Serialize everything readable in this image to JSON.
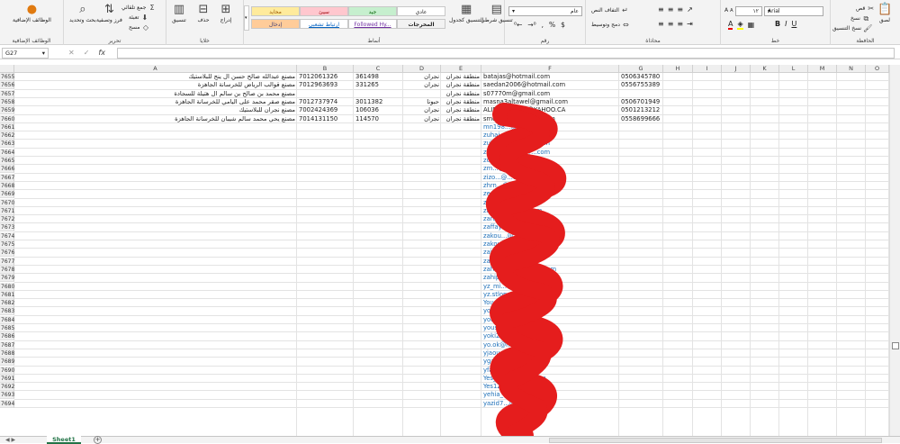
{
  "ribbon": {
    "clipboard": {
      "paste": "لصق",
      "cut": "قص",
      "copy": "نسخ",
      "format_painter": "نسخ التنسيق",
      "label": "الحافظة"
    },
    "font": {
      "name": "Arial",
      "size": "١٢",
      "label": "خط"
    },
    "alignment": {
      "wrap": "التفاف النص",
      "merge": "دمج وتوسيط",
      "label": "محاذاة"
    },
    "number": {
      "format": "عام",
      "label": "رقم"
    },
    "styles": {
      "conditional": "تنسيق شرطي",
      "as_table": "التنسيق كجدول",
      "cells": [
        "عادي",
        "جيد",
        "سيئ",
        "محايد",
        "المخرجات",
        "Followed Hy...",
        "ارتباط تشعبي",
        "إدخال"
      ],
      "label": "أنماط"
    },
    "cells": {
      "insert": "إدراج",
      "delete": "حذف",
      "format": "تنسيق",
      "label": "خلايا"
    },
    "editing": {
      "autosum": "جمع تلقائي",
      "fill": "تعبئة",
      "clear": "مسح",
      "sort": "فرز وتصفية",
      "find": "بحث وتحديد",
      "label": "تحرير"
    },
    "addins": {
      "button": "الوظائف الإضافية",
      "label": "الوظائف الإضافية"
    }
  },
  "formula_bar": {
    "name_box": "G27",
    "fx": "fx",
    "value": ""
  },
  "columns": [
    "A",
    "B",
    "C",
    "D",
    "E",
    "F",
    "G",
    "H",
    "I",
    "J",
    "K",
    "L",
    "M",
    "N",
    "O"
  ],
  "rows": [
    {
      "n": "7655",
      "a": "مصنع عبدالله صالح حسن ال ينج للبلاستيك",
      "b": "7012061326",
      "c": "361498",
      "d": "نجران",
      "e": "منطقة نجران",
      "f": "batajas@hotmail.com",
      "g": "0506345780"
    },
    {
      "n": "7656",
      "a": "مصنع قوالب الرياض للخرسانة الجاهزة",
      "b": "7012963693",
      "c": "331265",
      "d": "نجران",
      "e": "منطقة نجران",
      "f": "saedan2006@hotmail.com",
      "g": "0556755389"
    },
    {
      "n": "7657",
      "a": "مصنع محمد بن صالح بن سالم ال هتيلة للسجادة",
      "b": "",
      "c": "",
      "d": "",
      "e": "منطقة نجران",
      "f": "s07770m@gmail.com",
      "g": ""
    },
    {
      "n": "7658",
      "a": "مصنع صقر محمد على اليامي للخرسانة الجاهزة",
      "b": "7012737974",
      "c": "3011382",
      "d": "حبونا",
      "e": "منطقة نجران",
      "f": "masna3altawel@gmail.com",
      "g": "0506701949"
    },
    {
      "n": "7659",
      "a": "مصنع نجران للبلاستيك",
      "b": "7002424369",
      "c": "106036",
      "d": "نجران",
      "e": "منطقة نجران",
      "f": "ALIBALHARITH@YAHOO.CA",
      "g": "0501213212"
    },
    {
      "n": "7660",
      "a": "مصنع يحي محمد سالم شيبان للخرسانة الجاهزة",
      "b": "7014131150",
      "c": "114570",
      "d": "نجران",
      "e": "منطقة نجران",
      "f": "smo_666@hotmail.com",
      "g": "0558699666"
    },
    {
      "n": "7661",
      "f": "mn198...@..."
    },
    {
      "n": "7662",
      "f": "zuhai...@..."
    },
    {
      "n": "7663",
      "f": "zuhair.ghan...@...com"
    },
    {
      "n": "7664",
      "f": "zuhairalgha...@...com"
    },
    {
      "n": "7665",
      "f": "zoy...@...com"
    },
    {
      "n": "7666",
      "f": "zm...@...com"
    },
    {
      "n": "7667",
      "f": "zizo...@...com"
    },
    {
      "n": "7668",
      "f": "zhrn...@..."
    },
    {
      "n": "7669",
      "f": "zeeefes...@...om"
    },
    {
      "n": "7670",
      "f": "zayed...@...m.sa"
    },
    {
      "n": "7671",
      "f": "zanayem...@...com"
    },
    {
      "n": "7672",
      "f": "zaree_n...@...m"
    },
    {
      "n": "7673",
      "f": "zaffay...@..."
    },
    {
      "n": "7674",
      "f": "zakou...@...sa"
    },
    {
      "n": "7675",
      "f": "zakou...@...oader.org"
    },
    {
      "n": "7676",
      "f": "zain@a...@..."
    },
    {
      "n": "7677",
      "f": "zahr...@...com"
    },
    {
      "n": "7678",
      "f": "zahra...@...hotmail.com"
    },
    {
      "n": "7679",
      "f": "zahip...@...com"
    },
    {
      "n": "7680",
      "f": "yz_mi...@...com"
    },
    {
      "n": "7681",
      "f": "yz.stlop...@...com"
    },
    {
      "n": "7682",
      "f": "Yousse...@...mail.com"
    },
    {
      "n": "7683",
      "f": "yous...@...com"
    },
    {
      "n": "7684",
      "f": "yous...@...com.sa"
    },
    {
      "n": "7685",
      "f": "yous...@...yahoo.com"
    },
    {
      "n": "7686",
      "f": "yoki20...@...m"
    },
    {
      "n": "7687",
      "f": "yo.ok@h...@...om"
    },
    {
      "n": "7688",
      "f": "yjaou...@...m"
    },
    {
      "n": "7689",
      "f": "ygam...@...a.com"
    },
    {
      "n": "7690",
      "f": "yfak...@...m"
    },
    {
      "n": "7691",
      "f": "Yes_7...@...mail.com"
    },
    {
      "n": "7692",
      "f": "Yes12...@...ail.com"
    },
    {
      "n": "7693",
      "f": "yehia_...@...mail.com"
    },
    {
      "n": "7694",
      "f": "yazid7...@...com"
    }
  ],
  "sheet_tabs": {
    "active": "Sheet1",
    "add": "+"
  }
}
